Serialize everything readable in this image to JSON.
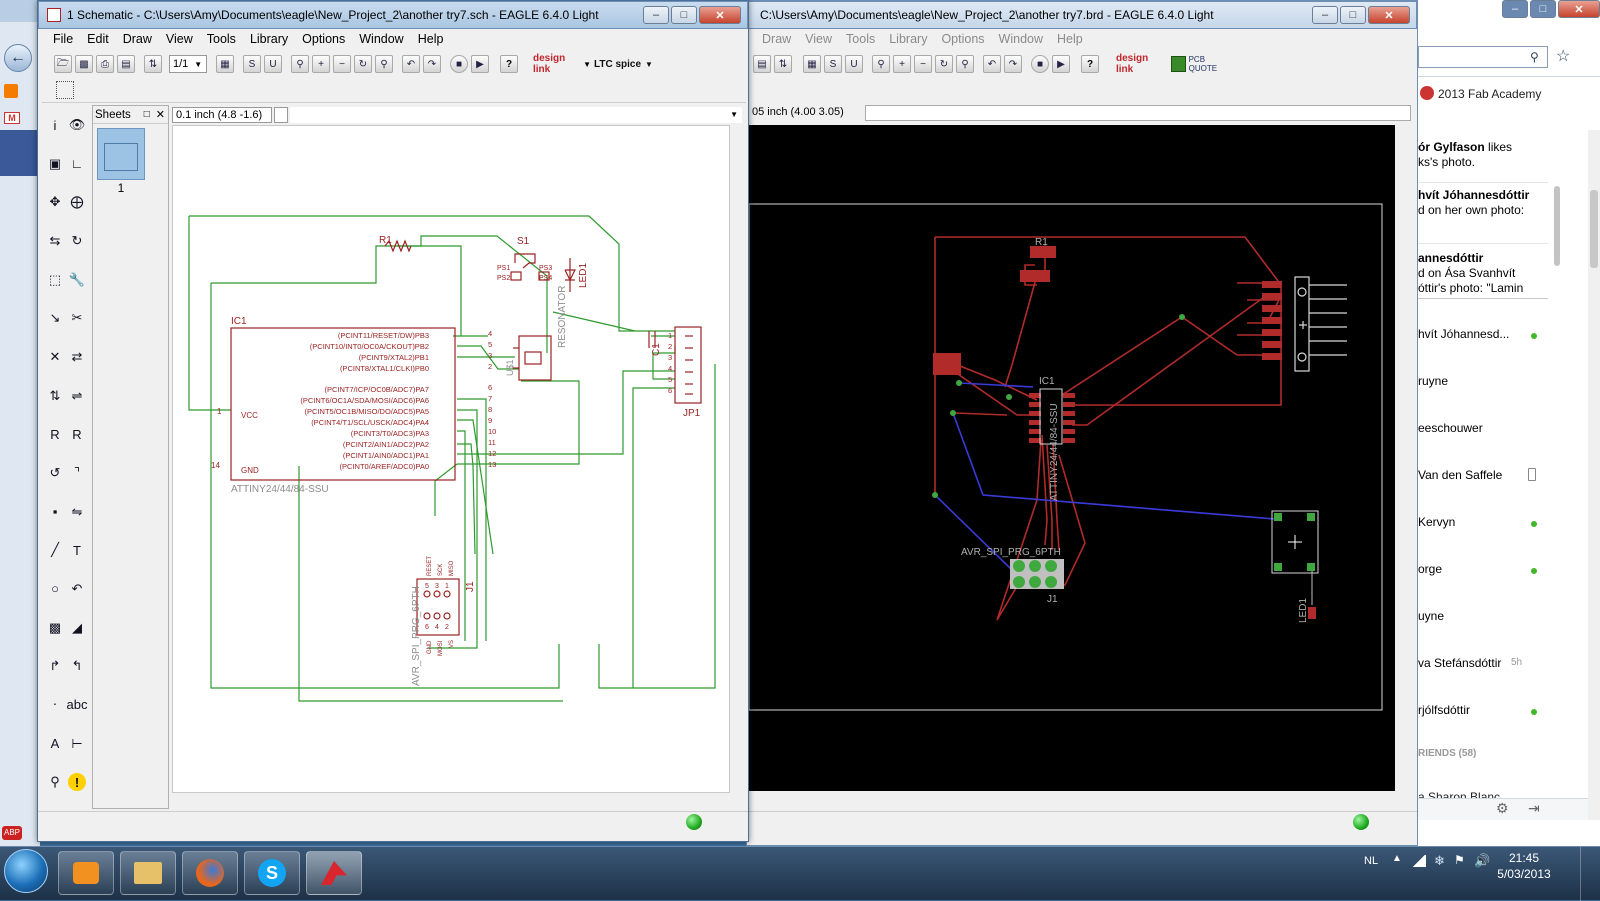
{
  "schematic": {
    "title": "1 Schematic - C:\\Users\\Amy\\Documents\\eagle\\New_Project_2\\another try7.sch - EAGLE 6.4.0 Light",
    "menu": [
      "File",
      "Edit",
      "Draw",
      "View",
      "Tools",
      "Library",
      "Options",
      "Window",
      "Help"
    ],
    "sheet_select": "1/1",
    "sheets_label": "Sheets",
    "sheet_number": "1",
    "coord": "0.1 inch (4.8 -1.6)",
    "brand_design_link": "design link",
    "brand_ltc": "LTC spice",
    "labels": {
      "r1": "R1",
      "s1": "S1",
      "ic1": "IC1",
      "c1": "C1",
      "jp1": "JP1",
      "j1": "J1",
      "led1": "LED1",
      "resonator": "RESONATOR",
      "u1": "U$1",
      "vcc": "VCC",
      "gnd": "GND",
      "ic_name": "ATTINY24/44/84-SSU",
      "avr": "AVR_SPI_PRG_6PTH",
      "ps1": "PS1",
      "ps2": "PS2",
      "ps3": "PS3",
      "ps4": "PS4",
      "reset": "RESET",
      "sck": "SCK",
      "miso": "MISO",
      "gnd_pin": "GND",
      "mosi": "MOSI",
      "vs": "VS"
    },
    "ic_pins_right": [
      {
        "name": "(PCINT11/RESET/DW)PB3",
        "num": "4"
      },
      {
        "name": "(PCINT10/INT0/OC0A/CKOUT)PB2",
        "num": "5"
      },
      {
        "name": "(PCINT9/XTAL2)PB1",
        "num": "3"
      },
      {
        "name": "(PCINT8/XTAL1/CLKI)PB0",
        "num": "2"
      },
      {
        "name": "(PCINT7/ICP/OC0B/ADC7)PA7",
        "num": "6"
      },
      {
        "name": "(PCINT6/OC1A/SDA/MOSI/ADC6)PA6",
        "num": "7"
      },
      {
        "name": "(PCINT5/OC1B/MISO/DO/ADC5)PA5",
        "num": "8"
      },
      {
        "name": "(PCINT4/T1/SCL/USCK/ADC4)PA4",
        "num": "9"
      },
      {
        "name": "(PCINT3/T0/ADC3)PA3",
        "num": "10"
      },
      {
        "name": "(PCINT2/AIN1/ADC2)PA2",
        "num": "11"
      },
      {
        "name": "(PCINT1/AIN0/ADC1)PA1",
        "num": "12"
      },
      {
        "name": "(PCINT0/AREF/ADC0)PA0",
        "num": "13"
      }
    ],
    "ic_pin_vcc": "1",
    "ic_pin_gnd": "14",
    "jp1_pins": [
      "1",
      "2",
      "3",
      "4",
      "5",
      "6"
    ],
    "j1_pins_top": [
      "5",
      "3",
      "1"
    ],
    "j1_pins_bottom": [
      "6",
      "4",
      "2"
    ]
  },
  "board": {
    "title": "C:\\Users\\Amy\\Documents\\eagle\\New_Project_2\\another try7.brd - EAGLE 6.4.0 Light",
    "menu": [
      "Draw",
      "View",
      "Tools",
      "Library",
      "Options",
      "Window",
      "Help"
    ],
    "coord": "05 inch (4.00 3.05)",
    "brand_design_link": "design link",
    "brand_pcb_quote": "PCB QUOTE",
    "labels": {
      "r1": "R1",
      "ic1": "IC1",
      "ic_name": "ATTINY24/44/84-SSU",
      "avr": "AVR_SPI_PRG_6PTH",
      "j1": "J1",
      "led1": "LED1"
    }
  },
  "facebook": {
    "group": "2013 Fab Academy",
    "feed": [
      {
        "bold": "ór Gylfason",
        "text": " likes",
        "line2": "ks's photo."
      },
      {
        "bold": "hvít Jóhannesdóttir",
        "text": "",
        "line2": "d on her own photo:"
      },
      {
        "bold": "annesdóttir",
        "text": "",
        "line2": "d on Ása Svanhvít",
        "line3": "óttir's photo: \"Lamin"
      }
    ],
    "chat": [
      {
        "name": "hvít Jóhannesd...",
        "status": "online"
      },
      {
        "name": "ruyne",
        "status": ""
      },
      {
        "name": "eeschouwer",
        "status": ""
      },
      {
        "name": "Van den Saffele",
        "status": "mobile"
      },
      {
        "name": "Kervyn",
        "status": "online"
      },
      {
        "name": "orge",
        "status": "online"
      },
      {
        "name": "uyne",
        "status": ""
      },
      {
        "name": "va Stefánsdóttir",
        "status": "5h"
      },
      {
        "name": "rjólfsdóttir",
        "status": "online"
      }
    ],
    "friends_header": "RIENDS (58)",
    "last_name": "a Sharon Blanc"
  },
  "taskbar": {
    "lang": "NL",
    "time": "21:45",
    "date": "5/03/2013"
  },
  "colors": {
    "schematic_wire": "#2e9a2e",
    "schematic_part": "#9b2222",
    "board_bg": "#000000",
    "top_copper": "#b12b2b",
    "bottom_copper": "#3a3ad8",
    "via": "#3fa83f"
  }
}
